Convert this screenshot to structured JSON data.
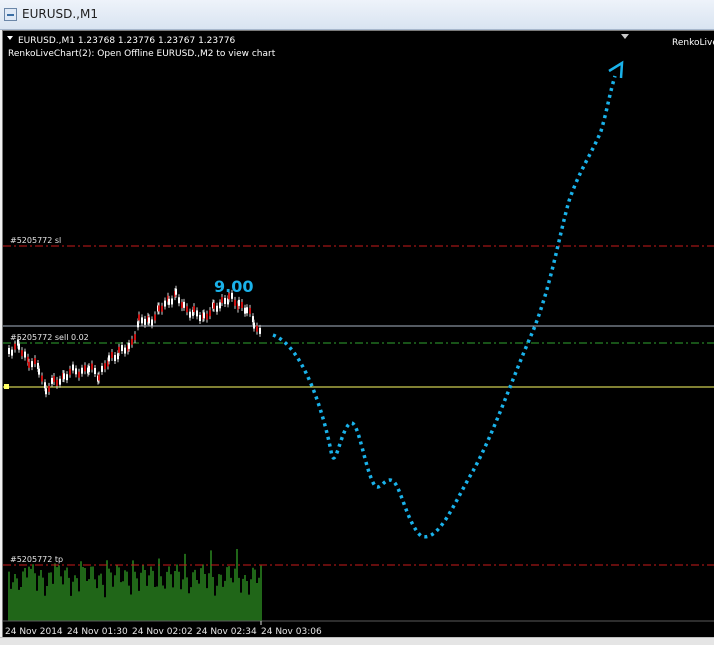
{
  "window": {
    "title": "EURUSD.,M1"
  },
  "header": {
    "symbol_line": "EURUSD.,M1  1.23768 1.23776 1.23767 1.23776",
    "indicator_line": "RenkoLiveChart(2): Open Offline EURUSD.,M2 to view chart",
    "right_label": "RenkoLive"
  },
  "levels": {
    "sl_label": "#5205772 sl",
    "sell_label": "#5205772 sell 0.02",
    "tp_label": "#5205772 tp"
  },
  "annotation": {
    "value": "9.00"
  },
  "time_axis": [
    "24 Nov 2014",
    "24 Nov 01:30",
    "24 Nov 02:02",
    "24 Nov 02:34",
    "24 Nov 03:06"
  ],
  "colors": {
    "background": "#000000",
    "up_candle": "#ffffff",
    "down_candle": "#cc1010",
    "sl_line": "#c81a1a",
    "sell_line": "#2fa52f",
    "current_price_line": "#ffff66",
    "annotation": "#1ab2ea",
    "volume": "#3fcc2f"
  }
}
